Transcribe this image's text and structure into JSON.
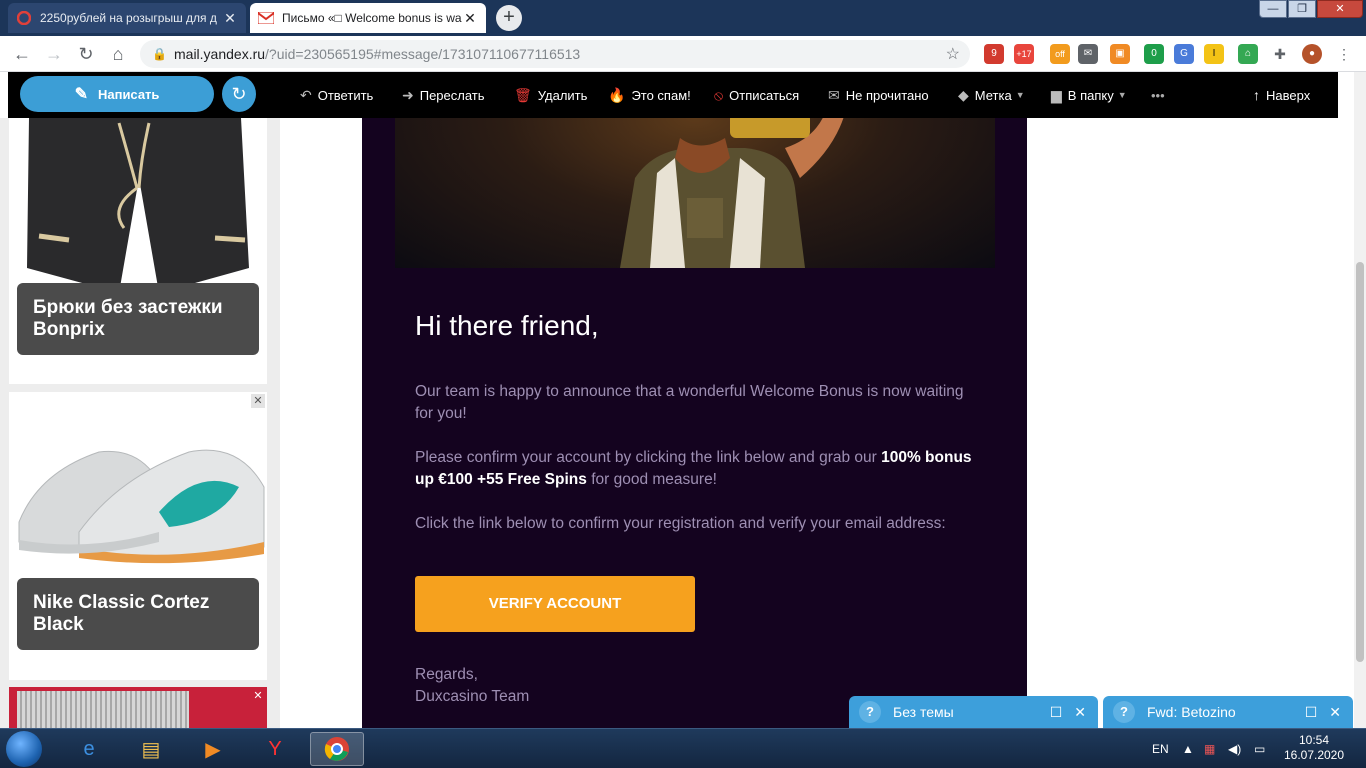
{
  "browser": {
    "tabs": [
      {
        "title": "2250рублей на розыгрыш для д",
        "active": false
      },
      {
        "title": "Письмо «□ Welcome bonus is wa",
        "active": true
      }
    ],
    "url_host": "mail.yandex.ru",
    "url_rest": "/?uid=230565195#message/173107110677116513",
    "extension_badges": [
      "9",
      "+17",
      "off",
      "0"
    ]
  },
  "mail": {
    "compose_label": "Написать",
    "actions": {
      "reply": "Ответить",
      "forward": "Переслать",
      "delete": "Удалить",
      "spam": "Это спам!",
      "unsubscribe": "Отписаться",
      "unread": "Не прочитано",
      "label": "Метка",
      "folder": "В папку",
      "more": "•••",
      "top": "Наверх"
    }
  },
  "ads": [
    {
      "label": "Брюки без застежки Bonprix"
    },
    {
      "label": "Nike Classic Cortez Black"
    }
  ],
  "email": {
    "greeting": "Hi there friend,",
    "para1": "Our team is happy to announce that a wonderful Welcome Bonus is now waiting for you!",
    "para2_pre": "Please confirm your account by clicking the link below and grab our ",
    "para2_bold": "100% bonus up €100 +55 Free Spins",
    "para2_post": " for good measure!",
    "para3": "Click the link below to confirm your registration and verify your email address:",
    "button": "VERIFY ACCOUNT",
    "regards": "Regards,",
    "team": "Duxcasino Team"
  },
  "chats": [
    {
      "title": "Без темы",
      "icon": "?"
    },
    {
      "title": "Fwd: Betozino",
      "icon": "?"
    }
  ],
  "taskbar": {
    "lang": "EN",
    "time": "10:54",
    "date": "16.07.2020"
  },
  "colors": {
    "accent": "#3c9ed6",
    "button": "#f6a11e",
    "email_bg": "#14031f"
  }
}
